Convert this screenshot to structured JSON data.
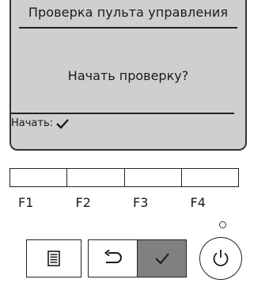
{
  "screen": {
    "title": "Проверка пульта управления",
    "prompt": "Начать проверку?",
    "confirm_label": "Начать:",
    "confirm_icon": "check-icon"
  },
  "function_keys": {
    "labels": [
      "F1",
      "F2",
      "F3",
      "F4"
    ]
  },
  "buttons": {
    "menu_icon": "menu-list-icon",
    "back_icon": "return-arrow-icon",
    "ok_icon": "check-icon",
    "power_icon": "power-icon"
  },
  "colors": {
    "screen_bg": "#cfcfcf",
    "ok_button_bg": "#808080"
  }
}
